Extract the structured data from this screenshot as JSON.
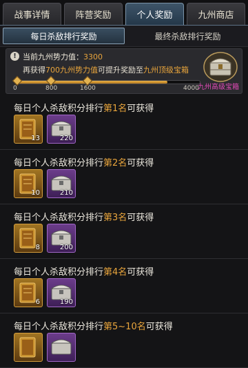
{
  "tabs": [
    {
      "label": "战事详情"
    },
    {
      "label": "阵营奖励"
    },
    {
      "label": "个人奖励",
      "active": true
    },
    {
      "label": "九州商店"
    }
  ],
  "subtabs": [
    {
      "label": "每日杀敌排行奖励",
      "active": true
    },
    {
      "label": "最终杀敌排行奖励"
    }
  ],
  "progress": {
    "power_label": "当前九州势力值：",
    "power_value": "3300",
    "hint_prefix": "再获得",
    "hint_amount": "700九州势力值",
    "hint_mid": "可提升奖励至",
    "hint_target": "九州顶级宝箱",
    "ticks": [
      "0",
      "800",
      "1600",
      "4000"
    ],
    "fill_fraction": 0.825,
    "chest_label": "九州高级宝箱"
  },
  "rewards": [
    {
      "prefix": "每日个人杀敌积分排行",
      "rank": "第1名",
      "suffix": "可获得",
      "book_count": "13",
      "chest_count": "220"
    },
    {
      "prefix": "每日个人杀敌积分排行",
      "rank": "第2名",
      "suffix": "可获得",
      "book_count": "10",
      "chest_count": "210"
    },
    {
      "prefix": "每日个人杀敌积分排行",
      "rank": "第3名",
      "suffix": "可获得",
      "book_count": "8",
      "chest_count": "200"
    },
    {
      "prefix": "每日个人杀敌积分排行",
      "rank": "第4名",
      "suffix": "可获得",
      "book_count": "6",
      "chest_count": "190"
    },
    {
      "prefix": "每日个人杀敌积分排行",
      "rank": "第5~10名",
      "suffix": "可获得",
      "book_count": "",
      "chest_count": ""
    }
  ],
  "icons": {
    "book": "golden-book-icon",
    "chest": "silver-chest-icon",
    "big_chest": "treasure-chest-icon",
    "info": "info-icon"
  },
  "colors": {
    "accent": "#e9a53c",
    "chest_label": "#e24bb8"
  }
}
